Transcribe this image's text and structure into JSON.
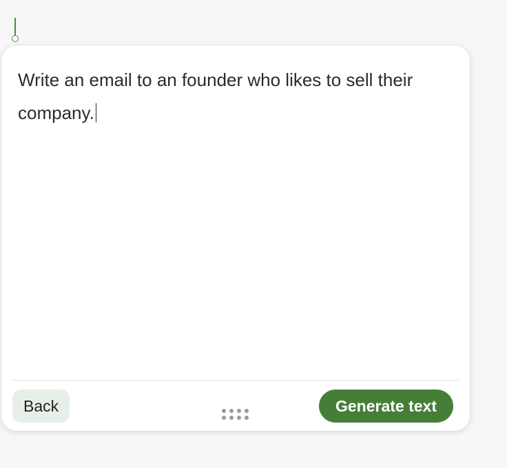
{
  "prompt": {
    "text": "Write an email to an founder who likes to sell their company."
  },
  "footer": {
    "back_label": "Back",
    "drag_icon": "drag-handle-icon",
    "generate_label": "Generate text"
  },
  "colors": {
    "accent": "#457f37",
    "back_bg": "#e8efe9",
    "panel_bg": "#ffffff",
    "page_bg": "#f7f7f7"
  }
}
